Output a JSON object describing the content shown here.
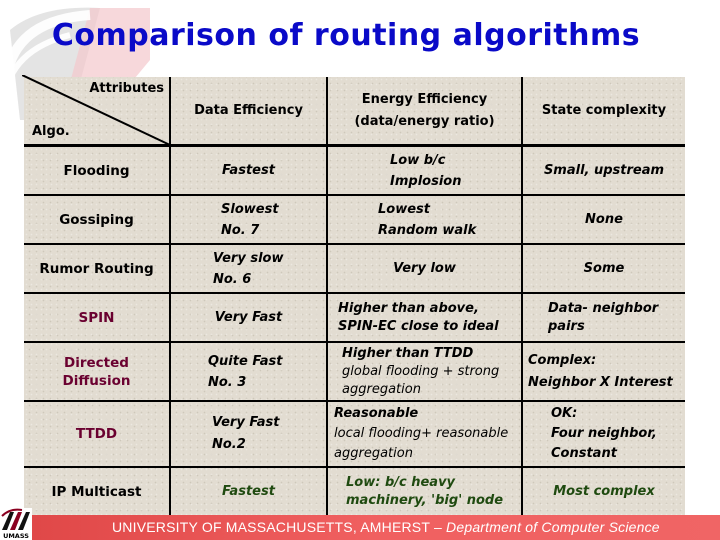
{
  "slide": {
    "title": "Comparison of routing algorithms",
    "title_color": "#0a0ac8"
  },
  "table": {
    "corner": {
      "top_label": "Attributes",
      "bottom_label": "Algo."
    },
    "headers": [
      "Data Efficiency",
      "Energy Efficiency",
      "(data/energy ratio)",
      "State complexity"
    ],
    "rows": [
      {
        "algo": "Flooding",
        "data_eff": [
          "Fastest"
        ],
        "energy_eff": [
          "Low b/c",
          "Implosion"
        ],
        "state": [
          "Small, upstream"
        ]
      },
      {
        "algo": "Gossiping",
        "data_eff": [
          "Slowest",
          "No. 7"
        ],
        "energy_eff": [
          "Lowest",
          "Random walk"
        ],
        "state": [
          "None"
        ]
      },
      {
        "algo": "Rumor Routing",
        "data_eff": [
          "Very slow",
          "No. 6"
        ],
        "energy_eff": [
          "Very low"
        ],
        "state": [
          "Some"
        ]
      },
      {
        "algo": "SPIN",
        "data_eff": [
          "Very Fast"
        ],
        "energy_eff": [
          "Higher than above,",
          "SPIN-EC close to ideal"
        ],
        "state": [
          "Data- neighbor",
          "pairs"
        ]
      },
      {
        "algo_lines": [
          "Directed",
          "Diffusion"
        ],
        "data_eff": [
          "Quite Fast",
          "No. 3"
        ],
        "energy_eff": [
          "Higher than TTDD",
          "global flooding + strong",
          "aggregation"
        ],
        "state": [
          "Complex:",
          "Neighbor X Interest"
        ]
      },
      {
        "algo": "TTDD",
        "data_eff": [
          "Very Fast",
          "No.2"
        ],
        "energy_eff": [
          "Reasonable",
          "local flooding+ reasonable",
          "aggregation"
        ],
        "state": [
          "OK:",
          "Four neighbor,",
          "Constant"
        ]
      },
      {
        "algo": "IP Multicast",
        "data_eff": [
          "Fastest"
        ],
        "energy_eff": [
          "Low: b/c heavy",
          "machinery, 'big' node"
        ],
        "state": [
          "Most complex"
        ]
      }
    ],
    "colors": {
      "highlight_algo": "#6a0030",
      "ip_multicast_values": "#1f4a10",
      "background": "#e2dcd1"
    }
  },
  "footer": {
    "university": "UNIVERSITY OF MASSACHUSETTS, AMHERST",
    "separator": " – ",
    "department": "Department of Computer Science",
    "logo_label": "UMASS",
    "color": "#f06060"
  }
}
